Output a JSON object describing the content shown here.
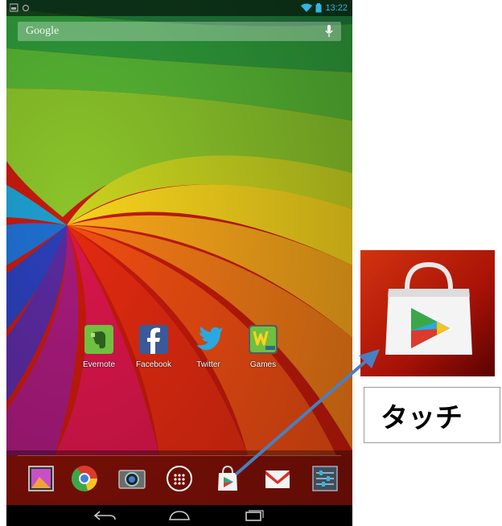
{
  "status_bar": {
    "time": "13:22"
  },
  "search": {
    "label": "Google",
    "mic_icon": "mic-icon"
  },
  "apps": [
    {
      "label": "Evernote",
      "icon": "evernote-icon",
      "color": "#6fbf40"
    },
    {
      "label": "Facebook",
      "icon": "facebook-icon",
      "color": "#3b5998"
    },
    {
      "label": "Twitter",
      "icon": "twitter-icon",
      "color": "#29a9e1"
    },
    {
      "label": "Games",
      "icon": "games-icon",
      "color": "#6fbf40"
    }
  ],
  "dock": [
    "gallery-icon",
    "chrome-icon",
    "camera-icon",
    "app-drawer-icon",
    "play-store-icon",
    "gmail-icon",
    "settings-icon"
  ],
  "nav": [
    "back-icon",
    "home-icon",
    "recents-icon"
  ],
  "callout": {
    "touch_label": "タッチ",
    "icon": "play-store-icon"
  },
  "colors": {
    "arrow": "#4a7fc1",
    "status_time": "#33b5e5"
  }
}
